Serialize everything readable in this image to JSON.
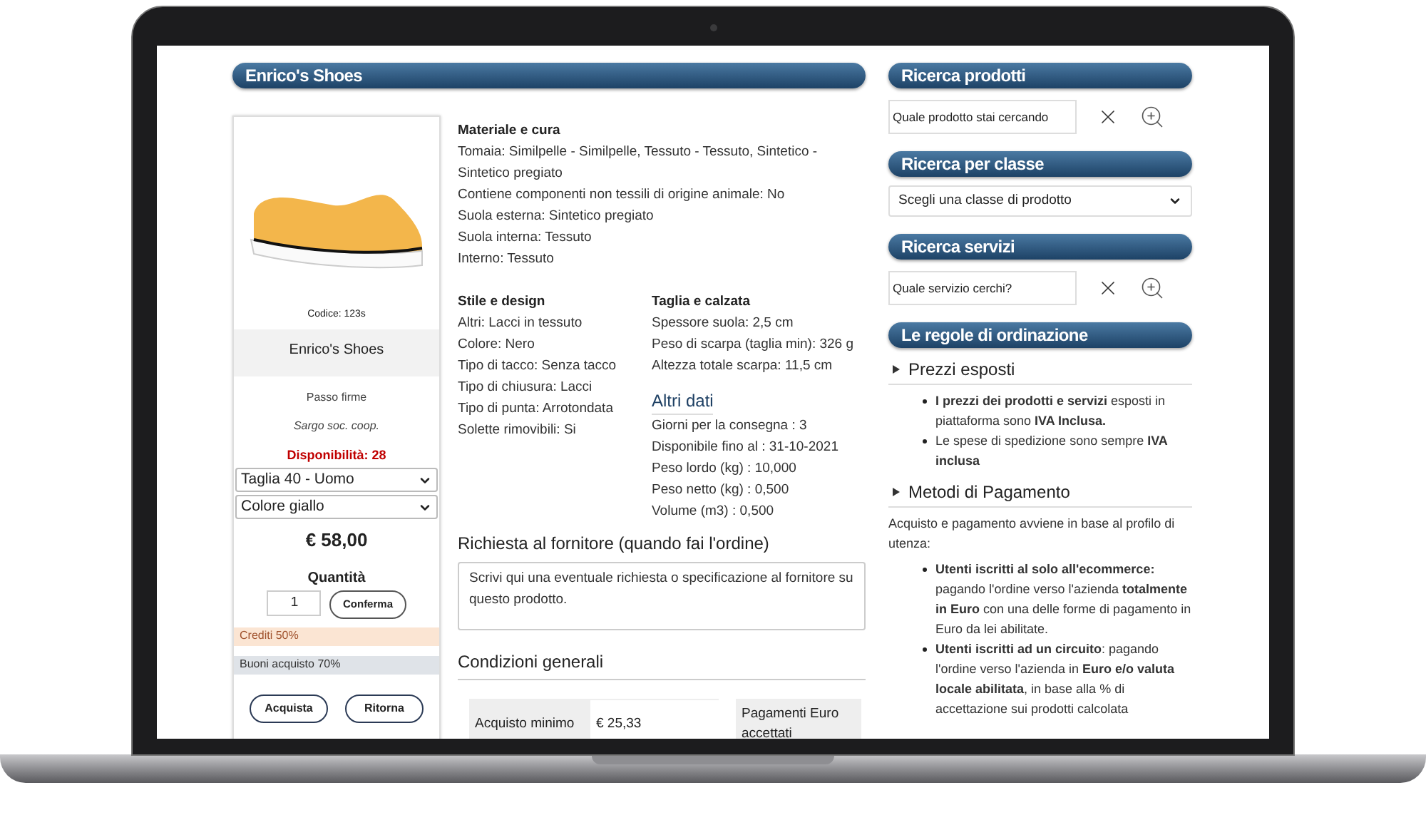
{
  "header": {
    "title": "Enrico's Shoes"
  },
  "product": {
    "code": "Codice: 123s",
    "name": "Enrico's Shoes",
    "brand_line": "Passo firme",
    "seller": "Sargo soc. coop.",
    "availability": "Disponibilità: 28",
    "size_select": {
      "value": "Taglia 40 - Uomo"
    },
    "color_select": {
      "value": "Colore giallo"
    },
    "price": "€ 58,00",
    "quantity_label": "Quantità",
    "quantity": "1",
    "confirm_button": "Conferma",
    "credits": "Crediti 50%",
    "vouchers": "Buoni acquisto 70%",
    "buttons": [
      "Acquista",
      "Ritorna"
    ]
  },
  "details": {
    "materials": {
      "title": "Materiale e cura",
      "lines": [
        "Tomaia: Similpelle - Similpelle, Tessuto - Tessuto, Sintetico - Sintetico pregiato",
        "Contiene componenti non tessili di origine animale: No",
        "Suola esterna: Sintetico pregiato",
        "Suola interna: Tessuto",
        "Interno: Tessuto"
      ]
    },
    "style": {
      "title": "Stile e design",
      "lines": [
        "Altri: Lacci in tessuto",
        "Colore: Nero",
        "Tipo di tacco: Senza tacco",
        "Tipo di chiusura: Lacci",
        "Tipo di punta: Arrotondata",
        "Solette rimovibili: Si"
      ]
    },
    "fit": {
      "title": "Taglia e calzata",
      "lines": [
        "Spessore suola: 2,5 cm",
        "Peso di scarpa (taglia min): 326 g",
        "Altezza totale scarpa: 11,5 cm"
      ]
    },
    "other": {
      "title": "Altri dati",
      "lines": [
        "Giorni per la consegna : 3",
        "Disponibile fino al : 31-10-2021",
        "Peso lordo (kg) : 10,000",
        "Peso netto (kg) : 0,500",
        "Volume (m3) : 0,500"
      ]
    }
  },
  "request": {
    "title": "Richiesta al fornitore (quando fai l'ordine)",
    "placeholder": "Scrivi qui una eventuale richiesta o specificazione al fornitore su questo prodotto."
  },
  "conditions": {
    "title": "Condizioni generali",
    "rows": [
      {
        "label": "Acquisto minimo",
        "value": "€ 25,33"
      }
    ],
    "note": "Pagamenti Euro accettati"
  },
  "product_search": {
    "title": "Ricerca prodotti",
    "placeholder": "Quale prodotto stai cercando"
  },
  "class_search": {
    "title": "Ricerca per classe",
    "value": "Scegli una classe di prodotto"
  },
  "service_search": {
    "title": "Ricerca servizi",
    "placeholder": "Quale servizio cerchi?"
  },
  "rules": {
    "title": "Le regole di ordinazione",
    "sections": [
      {
        "title": "Prezzi esposti",
        "items": [
          "**I prezzi dei prodotti e servizi** esposti in piattaforma sono **IVA Inclusa.**",
          "Le spese di spedizione sono sempre **IVA inclusa**"
        ]
      },
      {
        "title": "Metodi di Pagamento",
        "intro": "Acquisto e pagamento avviene in base al profilo di utenza:",
        "items": [
          "**Utenti iscritti al solo all'ecommerce:** pagando l'ordine verso l'azienda **totalmente in Euro** con una delle forme di pagamento in Euro da lei abilitate.",
          "**Utenti iscritti ad un circuito**: pagando l'ordine verso l'azienda in **Euro e/o valuta locale abilitata**, in base alla % di accettazione sui prodotti calcolata"
        ]
      }
    ]
  }
}
